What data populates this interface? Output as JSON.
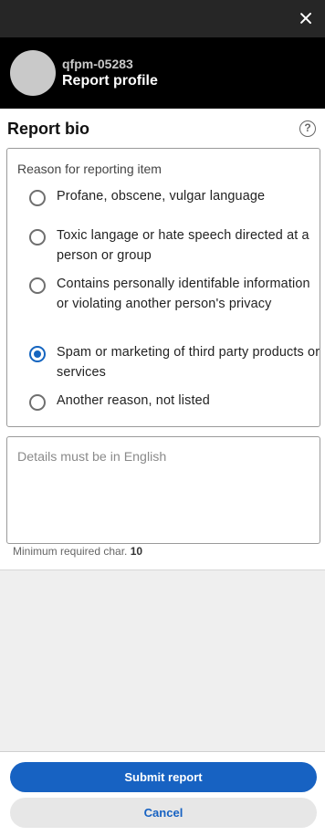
{
  "header": {
    "close_icon": "close-icon"
  },
  "profile": {
    "username": "qfpm-05283",
    "title": "Report profile"
  },
  "form": {
    "title": "Report bio",
    "help_icon_glyph": "?",
    "reason_legend": "Reason for reporting item",
    "options": [
      {
        "label": "Profane, obscene, vulgar language",
        "selected": false
      },
      {
        "label": "Toxic langage or hate speech directed at a person or group",
        "selected": false
      },
      {
        "label": "Contains personally identifable information or violating another person's privacy",
        "selected": false
      },
      {
        "label": "Spam or marketing of third party products or services",
        "selected": true
      },
      {
        "label": "Another reason, not listed",
        "selected": false
      }
    ],
    "details_value": "",
    "details_placeholder": "Details must be in English",
    "min_char_label": "Minimum required char.",
    "min_char_value": "10"
  },
  "footer": {
    "submit_label": "Submit report",
    "cancel_label": "Cancel"
  },
  "colors": {
    "accent": "#1762c2",
    "topbar": "#262626",
    "profile_bar": "#000000"
  }
}
